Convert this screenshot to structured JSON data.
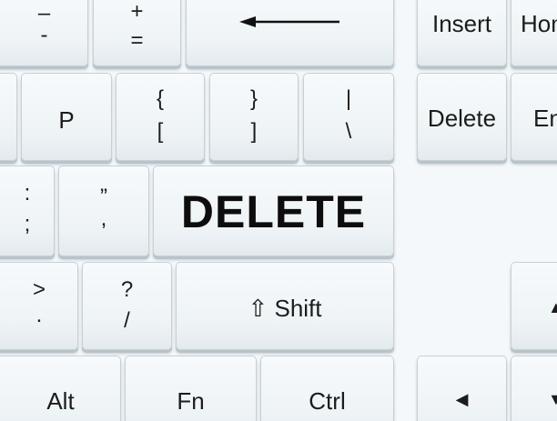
{
  "keys": {
    "minus_top": "–",
    "minus_bottom": "-",
    "plus_top": "+",
    "plus_bottom": "=",
    "insert": "Insert",
    "home_partial": "Hom",
    "p": "P",
    "brace_top": "{",
    "brace_bottom": "[",
    "rbrace_top": "}",
    "rbrace_bottom": "]",
    "pipe_top": "|",
    "pipe_bottom": "\\",
    "delete_small": "Delete",
    "end_partial": "En",
    "colon_top": ":",
    "colon_bottom": ";",
    "quote_top": "”",
    "quote_bottom": ",",
    "delete_big": "DELETE",
    "gt_top": ">",
    "gt_bottom": ".",
    "q_top": "?",
    "q_bottom": "/",
    "shift": "⇧ Shift",
    "alt": "Alt",
    "fn": "Fn",
    "ctrl": "Ctrl",
    "left_arrow": "◀",
    "up_arrow": "▲",
    "down_arrow": "▼"
  }
}
